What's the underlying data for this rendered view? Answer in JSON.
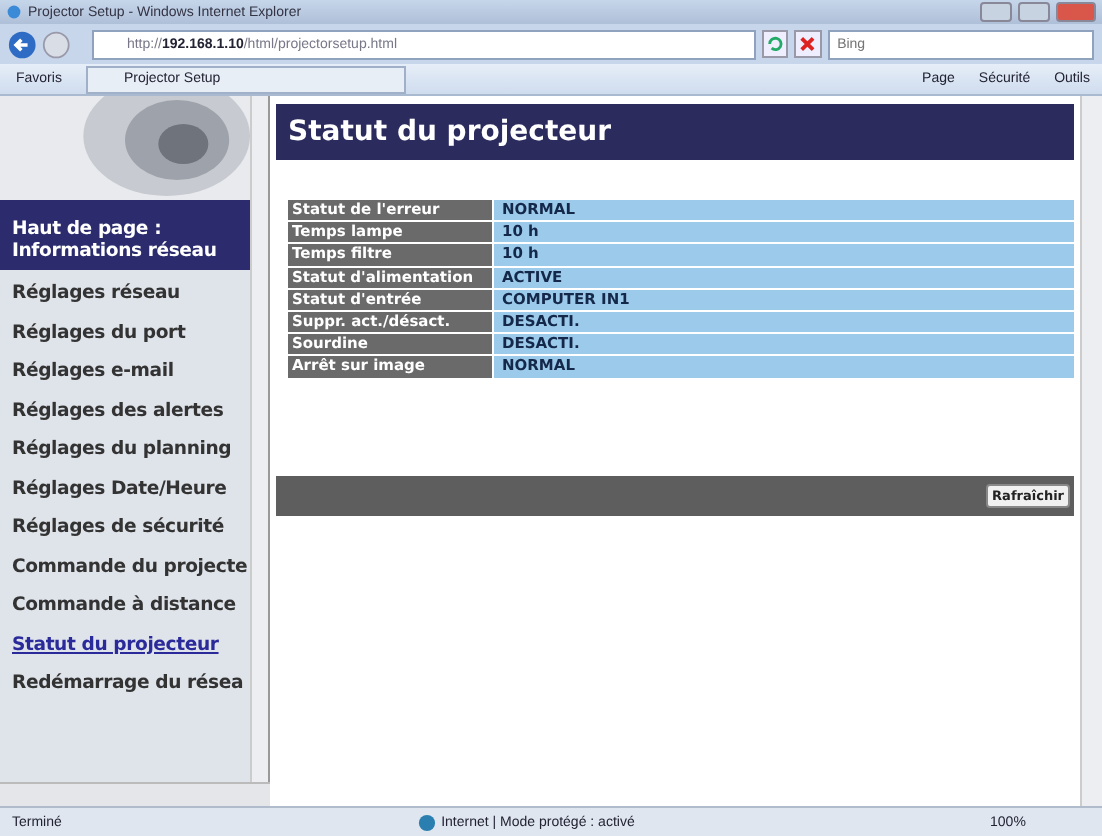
{
  "window": {
    "title": "Projector Setup - Windows Internet Explorer"
  },
  "address_bar": {
    "url_prefix": "http://",
    "url_host": "192.168.1.10",
    "url_path": "/html/projectorsetup.html"
  },
  "search": {
    "placeholder": "Bing"
  },
  "favorites": {
    "label": "Favoris"
  },
  "tab": {
    "label": "Projector Setup"
  },
  "command_bar": [
    {
      "label": "Page"
    },
    {
      "label": "Sécurité"
    },
    {
      "label": "Outils"
    }
  ],
  "sidebar": {
    "items": [
      {
        "label": "Haut de page : Informations réseau",
        "kind": "header",
        "selected": false
      },
      {
        "label": "Réglages réseau",
        "kind": "link",
        "selected": false
      },
      {
        "label": "Réglages du port",
        "kind": "link",
        "selected": false
      },
      {
        "label": "Réglages e-mail",
        "kind": "link",
        "selected": false
      },
      {
        "label": "Réglages des alertes",
        "kind": "link",
        "selected": false
      },
      {
        "label": "Réglages du planning",
        "kind": "link",
        "selected": false
      },
      {
        "label": "Réglages Date/Heure",
        "kind": "link",
        "selected": false
      },
      {
        "label": "Réglages de sécurité",
        "kind": "link",
        "selected": false
      },
      {
        "label": "Commande du projecte",
        "kind": "link",
        "selected": false
      },
      {
        "label": "Commande à distance",
        "kind": "link",
        "selected": false
      },
      {
        "label": "Statut du projecteur",
        "kind": "link",
        "selected": true
      },
      {
        "label": "Redémarrage du résea",
        "kind": "link",
        "selected": false
      }
    ]
  },
  "page_title": "Statut du projecteur",
  "status_table": {
    "rows": [
      {
        "label": "Statut de l'erreur",
        "value": "NORMAL"
      },
      {
        "label": "Temps lampe",
        "value": "10 h"
      },
      {
        "label": "Temps filtre",
        "value": "10 h"
      },
      {
        "label": "Statut d'alimentation",
        "value": "ACTIVE"
      },
      {
        "label": "Statut d'entrée",
        "value": "COMPUTER IN1"
      },
      {
        "label": "Suppr. act./désact.",
        "value": "DESACTI."
      },
      {
        "label": "Sourdine",
        "value": "DESACTI."
      },
      {
        "label": "Arrêt sur image",
        "value": "NORMAL"
      }
    ]
  },
  "refresh_button": {
    "label": "Rafraîchir"
  },
  "status_bar": {
    "text": "Terminé",
    "zone": "Internet | Mode protégé : activé",
    "zoom": "100%"
  }
}
